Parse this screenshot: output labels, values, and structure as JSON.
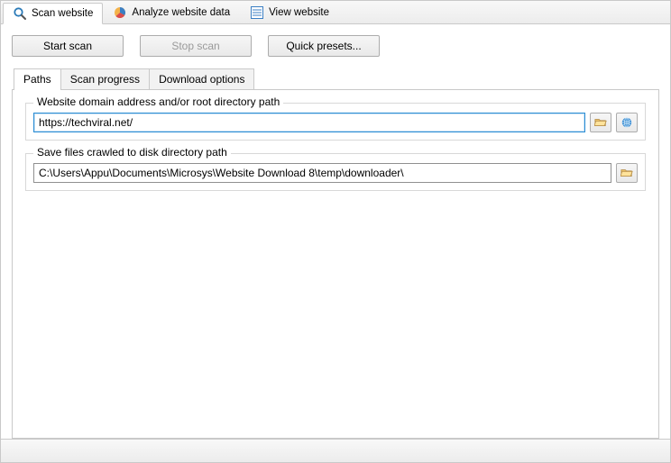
{
  "toolbar": {
    "scan_website": "Scan website",
    "analyze_data": "Analyze website data",
    "view_website": "View website"
  },
  "buttons": {
    "start_scan": "Start scan",
    "stop_scan": "Stop scan",
    "quick_presets": "Quick presets..."
  },
  "tabs": {
    "paths": "Paths",
    "scan_progress": "Scan progress",
    "download_options": "Download options"
  },
  "groups": {
    "domain": {
      "label": "Website domain address and/or root directory path",
      "value": "https://techviral.net/"
    },
    "save_path": {
      "label": "Save files crawled to disk directory path",
      "value": "C:\\Users\\Appu\\Documents\\Microsys\\Website Download 8\\temp\\downloader\\"
    }
  }
}
